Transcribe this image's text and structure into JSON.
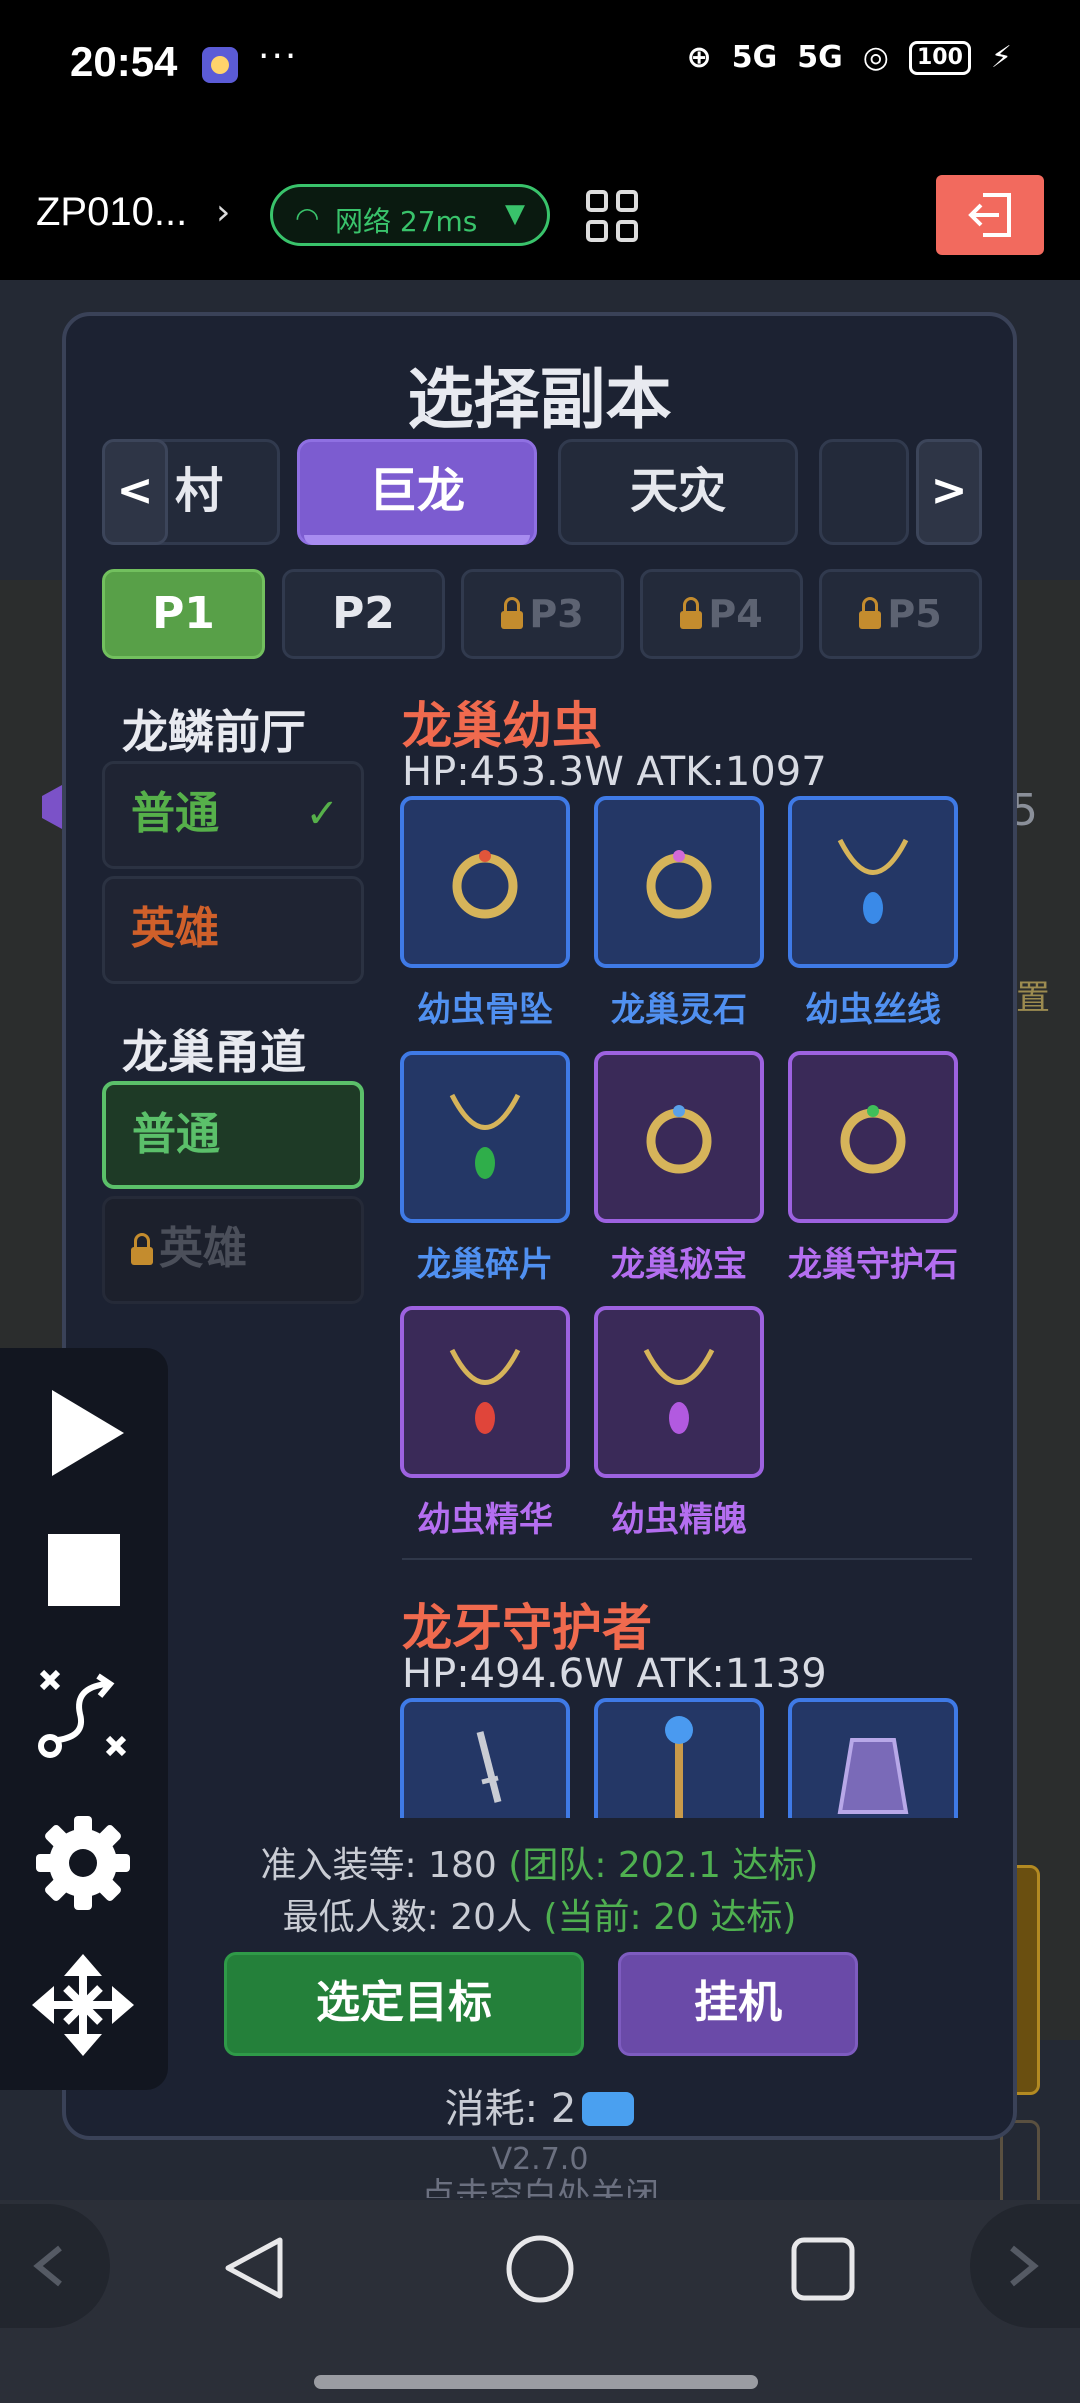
{
  "status_bar": {
    "time": "20:54",
    "dots": "···",
    "signal1": "5G",
    "signal2": "5G",
    "battery": "100"
  },
  "top_bar": {
    "server_name": "ZP010...",
    "network_label": "网络 27ms"
  },
  "background": {
    "right_char": "5",
    "right_char2": "置"
  },
  "modal": {
    "title": "选择副本",
    "category_tabs": [
      {
        "label": "村"
      },
      {
        "label": "巨龙",
        "active": true
      },
      {
        "label": "天灾"
      },
      {
        "label": ""
      }
    ],
    "phase_tabs": [
      {
        "label": "P1",
        "active": true
      },
      {
        "label": "P2"
      },
      {
        "label": "P3",
        "locked": true
      },
      {
        "label": "P4",
        "locked": true
      },
      {
        "label": "P5",
        "locked": true
      }
    ],
    "zones": [
      {
        "title": "龙鳞前厅",
        "difficulties": [
          {
            "label": "普通",
            "completed": true
          },
          {
            "label": "英雄"
          }
        ]
      },
      {
        "title": "龙巢甬道",
        "difficulties": [
          {
            "label": "普通",
            "selected": true
          },
          {
            "label": "英雄",
            "locked": true
          }
        ]
      }
    ],
    "bosses": [
      {
        "name": "龙巢幼虫",
        "stats": "HP:453.3W  ATK:1097",
        "drops": [
          {
            "name": "幼虫骨坠",
            "rarity": "blue",
            "icon": "ring-icon"
          },
          {
            "name": "龙巢灵石",
            "rarity": "blue",
            "icon": "ring-icon"
          },
          {
            "name": "幼虫丝线",
            "rarity": "blue",
            "icon": "necklace-icon"
          },
          {
            "name": "龙巢碎片",
            "rarity": "blue",
            "icon": "necklace-icon"
          },
          {
            "name": "龙巢秘宝",
            "rarity": "purple",
            "icon": "ring-icon"
          },
          {
            "name": "龙巢守护石",
            "rarity": "purple",
            "icon": "ring-icon"
          },
          {
            "name": "幼虫精华",
            "rarity": "purple",
            "icon": "necklace-icon"
          },
          {
            "name": "幼虫精魄",
            "rarity": "purple",
            "icon": "necklace-icon"
          }
        ]
      },
      {
        "name": "龙牙守护者",
        "stats": "HP:494.6W  ATK:1139",
        "drops": [
          {
            "icon": "dagger-icon",
            "rarity": "blue"
          },
          {
            "icon": "staff-icon",
            "rarity": "blue"
          },
          {
            "icon": "armor-icon",
            "rarity": "blue"
          }
        ]
      }
    ],
    "requirements": {
      "line1_prefix": "准入装等: 180 ",
      "line1_status": "(团队: 202.1 达标)",
      "line2_prefix": "最低人数: 20人 ",
      "line2_status": "(当前: 20 达标)"
    },
    "confirm_label": "选定目标",
    "idle_label": "挂机",
    "cost_label": "消耗: 2"
  },
  "footer": {
    "version": "V2.7.0",
    "close_hint": "点击空白处关闭"
  },
  "colors": {
    "accent_purple": "#7c5cd0",
    "accent_green": "#58a048",
    "boss_name": "#f06a4e",
    "rarity_blue": "#3f7ae6",
    "rarity_purple": "#9d62e0",
    "exit_red": "#f26a5e"
  }
}
